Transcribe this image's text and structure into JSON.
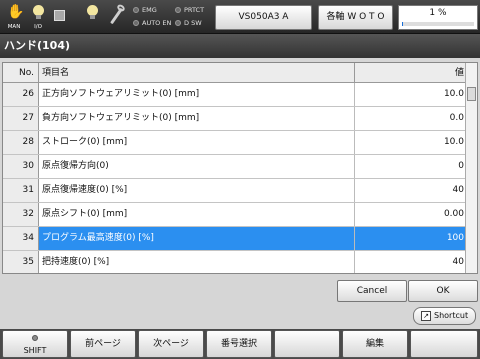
{
  "statusbar": {
    "man_label": "MAN",
    "io_label": "I/O",
    "emg_label": "EMG",
    "auto_en_label": "AUTO EN",
    "prtct_label": "PRTCT",
    "dsw_label": "D SW",
    "robot_button": "VS050A3 A",
    "axis_button": "各軸  W O T O",
    "speed_text": "1 %",
    "speed_percent": 1,
    "accent_color": "#1a6fd8"
  },
  "title": "ハンド(104)",
  "table": {
    "header": {
      "no": "No.",
      "name": "項目名",
      "value": "値"
    },
    "rows": [
      {
        "no": "26",
        "name": "正方向ソフトウェアリミット(0) [mm]",
        "value": "10.0"
      },
      {
        "no": "27",
        "name": "負方向ソフトウェアリミット(0) [mm]",
        "value": "0.0"
      },
      {
        "no": "28",
        "name": "ストローク(0) [mm]",
        "value": "10.0"
      },
      {
        "no": "30",
        "name": "原点復帰方向(0)",
        "value": "0"
      },
      {
        "no": "31",
        "name": "原点復帰速度(0) [%]",
        "value": "40"
      },
      {
        "no": "32",
        "name": "原点シフト(0) [mm]",
        "value": "0.00"
      },
      {
        "no": "34",
        "name": "プログラム最高速度(0) [%]",
        "value": "100"
      },
      {
        "no": "35",
        "name": "把持速度(0) [%]",
        "value": "40"
      }
    ],
    "selected_index": 6,
    "selection_color": "#2b8ff0"
  },
  "dialog": {
    "cancel": "Cancel",
    "ok": "OK",
    "shortcut": "Shortcut"
  },
  "function_keys": [
    "SHIFT",
    "前ページ",
    "次ページ",
    "番号選択",
    "",
    "編集",
    ""
  ]
}
